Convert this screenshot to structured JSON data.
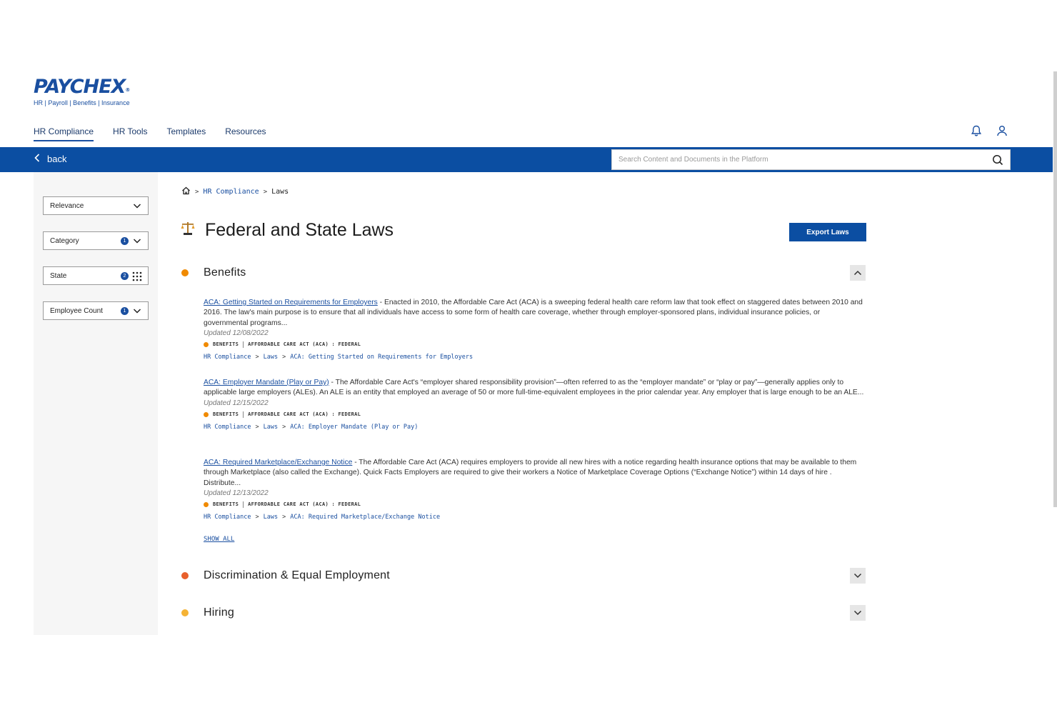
{
  "brand": {
    "name": "PAYCHEX",
    "trademark": "®",
    "tagline": "HR | Payroll | Benefits | Insurance",
    "color": "#1a4fa0"
  },
  "nav": {
    "items": [
      "HR Compliance",
      "HR Tools",
      "Templates",
      "Resources"
    ],
    "active": "HR Compliance"
  },
  "header_icons": [
    "bell-icon",
    "user-icon"
  ],
  "toolbar": {
    "back_label": "back",
    "search_placeholder": "Search Content and Documents in the Platform",
    "bar_color": "#0b4ea2"
  },
  "filters": [
    {
      "label": "Relevance",
      "badge": "",
      "control": "chevron-down-icon"
    },
    {
      "label": "Category",
      "badge": "1",
      "control": "chevron-down-icon"
    },
    {
      "label": "State",
      "badge": "2",
      "control": "grid-icon"
    },
    {
      "label": "Employee Count",
      "badge": "1",
      "control": "chevron-down-icon"
    }
  ],
  "breadcrumb": {
    "home_icon": "home-icon",
    "items": [
      "HR Compliance",
      "Laws"
    ]
  },
  "page": {
    "title": "Federal and State Laws",
    "title_icon": "scales-icon",
    "export_label": "Export Laws"
  },
  "sections": [
    {
      "name": "Benefits",
      "color": "#f08a00",
      "expanded": true,
      "laws": [
        {
          "title": "ACA: Getting Started on Requirements for Employers",
          "summary": " - Enacted in 2010, the Affordable Care Act (ACA) is a sweeping federal health care reform law that took effect on staggered dates between 2010 and 2016. The law's main purpose is to ensure that all individuals have access to some form of health care coverage, whether through employer-sponsored plans, individual insurance policies, or governmental programs...",
          "updated": "Updated 12/08/2022",
          "tags": [
            "BENEFITS",
            "AFFORDABLE CARE ACT (ACA) : FEDERAL"
          ],
          "path": [
            "HR Compliance",
            "Laws",
            "ACA: Getting Started on Requirements for Employers"
          ]
        },
        {
          "title": "ACA: Employer Mandate (Play or Pay)",
          "summary": " - The Affordable Care Act's “employer shared responsibility provision”—often referred to as the “employer mandate” or “play or pay”—generally applies only to applicable large employers (ALEs). An ALE is an entity that employed an average of 50 or more full-time-equivalent employees in the prior calendar year. Any employer that is large enough to be an ALE...",
          "updated": "Updated 12/15/2022",
          "tags": [
            "BENEFITS",
            "AFFORDABLE CARE ACT (ACA) : FEDERAL"
          ],
          "path": [
            "HR Compliance",
            "Laws",
            "ACA: Employer Mandate (Play or Pay)"
          ]
        },
        {
          "title": "ACA: Required Marketplace/Exchange Notice",
          "summary": " - The Affordable Care Act (ACA) requires employers to provide all new hires with a notice regarding health insurance options that may be available to them through Marketplace (also called the Exchange). Quick Facts Employers are required to give their workers a Notice of Marketplace Coverage Options (“Exchange Notice”) within 14 days of hire . Distribute...",
          "updated": "Updated 12/13/2022",
          "tags": [
            "BENEFITS",
            "AFFORDABLE CARE ACT (ACA) : FEDERAL"
          ],
          "path": [
            "HR Compliance",
            "Laws",
            "ACA: Required Marketplace/Exchange Notice"
          ]
        }
      ],
      "show_all_label": "SHOW ALL"
    },
    {
      "name": "Discrimination & Equal Employment",
      "color": "#e8602c",
      "expanded": false
    },
    {
      "name": "Hiring",
      "color": "#f5b335",
      "expanded": false
    }
  ]
}
